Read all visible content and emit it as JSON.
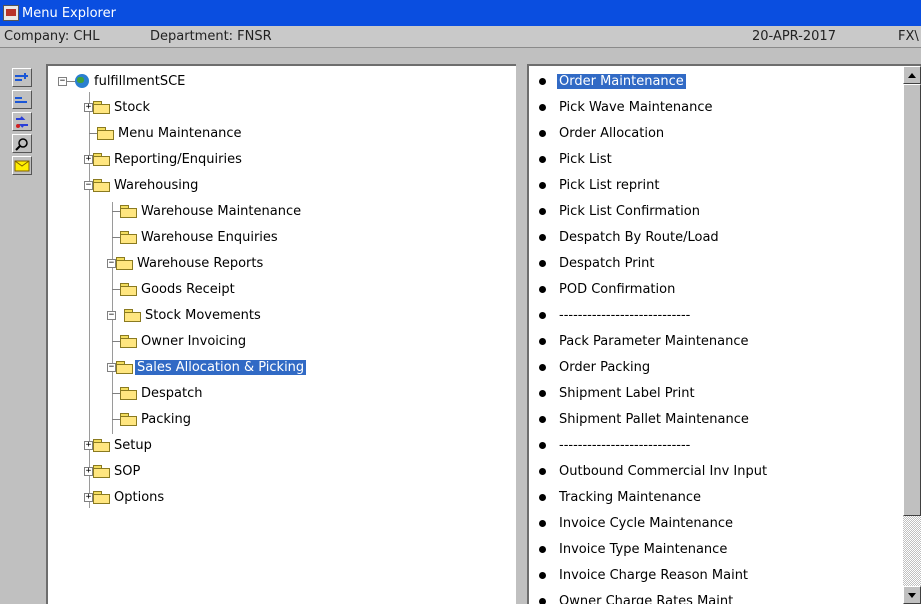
{
  "window": {
    "title": "Menu Explorer"
  },
  "info": {
    "company": "Company: CHL",
    "department": "Department: FNSR",
    "date": "20-APR-2017",
    "extra": "FX\\"
  },
  "toolbar": {
    "buttons": [
      "expand-all-icon",
      "collapse-all-icon",
      "refresh-icon",
      "find-icon",
      "mail-icon"
    ]
  },
  "tree": {
    "root": "fulfillmentSCE",
    "items": [
      {
        "label": "Stock"
      },
      {
        "label": "Menu Maintenance"
      },
      {
        "label": "Reporting/Enquiries"
      },
      {
        "label": "Warehousing"
      },
      {
        "label": "Warehouse Maintenance"
      },
      {
        "label": "Warehouse Enquiries"
      },
      {
        "label": "Warehouse Reports"
      },
      {
        "label": "Goods Receipt"
      },
      {
        "label": "Stock Movements"
      },
      {
        "label": "Owner Invoicing"
      },
      {
        "label": "Sales Allocation & Picking"
      },
      {
        "label": "Despatch"
      },
      {
        "label": "Packing"
      },
      {
        "label": "Setup"
      },
      {
        "label": "SOP"
      },
      {
        "label": "Options"
      }
    ]
  },
  "list": {
    "items": [
      "Order Maintenance",
      "Pick Wave Maintenance",
      "Order Allocation",
      "Pick List",
      "Pick List reprint",
      "Pick List Confirmation",
      "Despatch By Route/Load",
      "Despatch Print",
      "POD Confirmation",
      "----------------------------",
      "Pack Parameter Maintenance",
      "Order Packing",
      "Shipment Label Print",
      "Shipment Pallet Maintenance",
      "----------------------------",
      "Outbound Commercial Inv Input",
      "Tracking Maintenance",
      "Invoice Cycle Maintenance",
      "Invoice Type Maintenance",
      "Invoice Charge Reason Maint",
      "Owner Charge Rates Maint"
    ]
  }
}
